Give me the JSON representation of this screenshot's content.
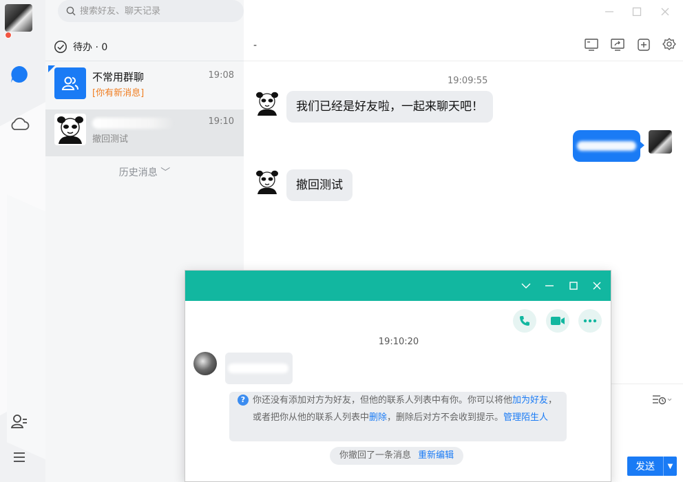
{
  "search": {
    "placeholder": "搜索好友、聊天记录"
  },
  "todo": {
    "label": "待办 · 0"
  },
  "conversations": [
    {
      "name": "不常用群聊",
      "time": "19:08",
      "sub": "[你有新消息]"
    },
    {
      "name": "",
      "time": "19:10",
      "sub": "撤回测试"
    }
  ],
  "history": {
    "label": "历史消息 ﹀"
  },
  "chat": {
    "title": "-",
    "messages": [
      {
        "time": "19:09:55",
        "text": "我们已经是好友啦，一起来聊天吧！"
      },
      {
        "text": "撤回测试"
      }
    ],
    "send_label": "发送"
  },
  "popup": {
    "time": "19:10:20",
    "notice": {
      "t1": "你还没有添加对方为好友，但他的联系人列表中有你。你可以将他",
      "link1": "加为好友",
      "t2": "，或者把你从他的联系人列表中",
      "link2": "删除",
      "t3": "，删除后对方不会收到提示。",
      "link3": "管理陌生人"
    },
    "recall": {
      "text": "你撤回了一条消息",
      "link": "重新编辑"
    }
  },
  "colors": {
    "brand_blue": "#1a7bf5",
    "popup_teal": "#12b7a0",
    "warn_orange": "#f07c1f",
    "badge_red": "#f25643"
  },
  "icons": [
    "search-icon",
    "todo-check-icon",
    "chat-bubble-icon",
    "cloud-icon",
    "contacts-icon",
    "menu-icon",
    "screen-icon",
    "screen-share-icon",
    "add-icon",
    "settings-icon",
    "phone-icon",
    "video-icon",
    "more-icon",
    "history-icon",
    "question-icon"
  ]
}
